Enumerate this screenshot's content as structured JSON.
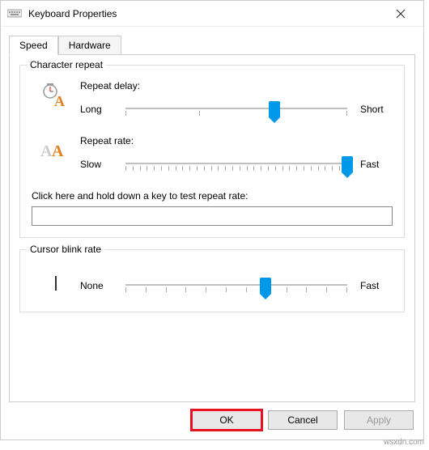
{
  "window": {
    "title": "Keyboard Properties"
  },
  "tabs": {
    "speed": "Speed",
    "hardware": "Hardware"
  },
  "characterRepeat": {
    "title": "Character repeat",
    "delay": {
      "label": "Repeat delay:",
      "left": "Long",
      "right": "Short",
      "positionPct": 67
    },
    "rate": {
      "label": "Repeat rate:",
      "left": "Slow",
      "right": "Fast",
      "positionPct": 100
    },
    "test": {
      "label": "Click here and hold down a key to test repeat rate:",
      "value": ""
    }
  },
  "cursorBlink": {
    "title": "Cursor blink rate",
    "left": "None",
    "right": "Fast",
    "positionPct": 63
  },
  "buttons": {
    "ok": "OK",
    "cancel": "Cancel",
    "apply": "Apply"
  },
  "watermark": "wsxdn.com"
}
